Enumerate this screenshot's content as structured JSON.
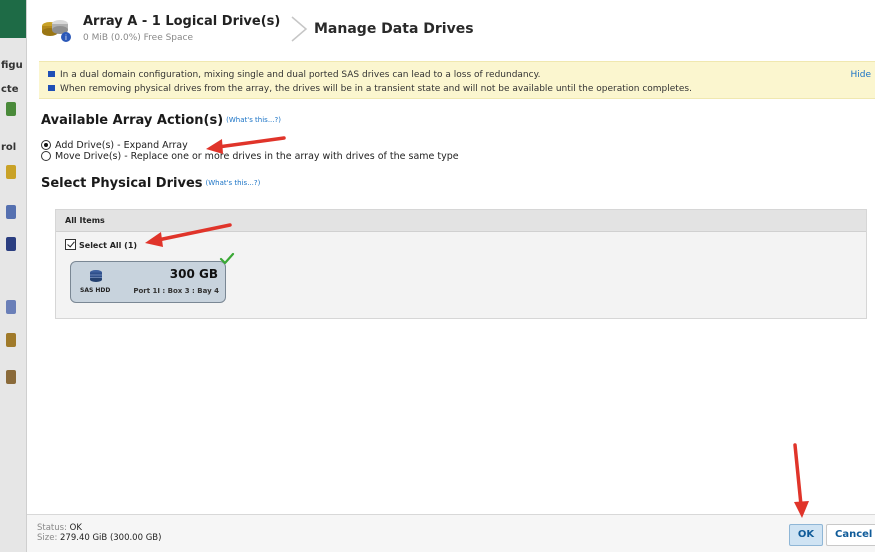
{
  "background": {
    "fragments": [
      "figu",
      "cte",
      "rol"
    ]
  },
  "header": {
    "array_title": "Array A - 1 Logical Drive(s)",
    "array_subtitle": "0 MiB (0.0%) Free Space",
    "page_title": "Manage Data Drives"
  },
  "warnings": {
    "lines": [
      "In a dual domain configuration, mixing single and dual ported SAS drives can lead to a loss of redundancy.",
      "When removing physical drives from the array, the drives will be in a transient state and will not be available until the operation completes."
    ],
    "hide_label": "Hide"
  },
  "actions": {
    "title": "Available Array Action(s)",
    "whats_this": "(What's this...?)",
    "options": [
      {
        "label": "Add Drive(s) - Expand Array",
        "selected": true
      },
      {
        "label": "Move Drive(s) - Replace one or more drives in the array with drives of the same type",
        "selected": false
      }
    ]
  },
  "drives": {
    "title": "Select Physical Drives",
    "whats_this": "(What's this...?)",
    "panel_header": "All Items",
    "select_all_label": "Select All (1)",
    "select_all_checked": true,
    "items": [
      {
        "size": "300 GB",
        "type": "SAS HDD",
        "location": "Port 1I : Box 3 : Bay 4",
        "selected": true
      }
    ]
  },
  "footer": {
    "status_label": "Status:",
    "status_value": "OK",
    "size_label": "Size:",
    "size_value": "279.40 GiB (300.00 GB)",
    "ok_label": "OK",
    "cancel_label": "Cancel"
  },
  "colors": {
    "accent": "#1a73c6",
    "warning_bg": "#fbf6cf",
    "annotation_arrow": "#e0342a",
    "check": "#3aa835",
    "brand_bar": "#1e6b46"
  },
  "icons": {
    "array": "array-drives-icon",
    "drive": "hdd-icon",
    "selected": "checkmark-icon",
    "breadcrumb": "chevron-right-icon",
    "bullet": "square-bullet-icon"
  }
}
